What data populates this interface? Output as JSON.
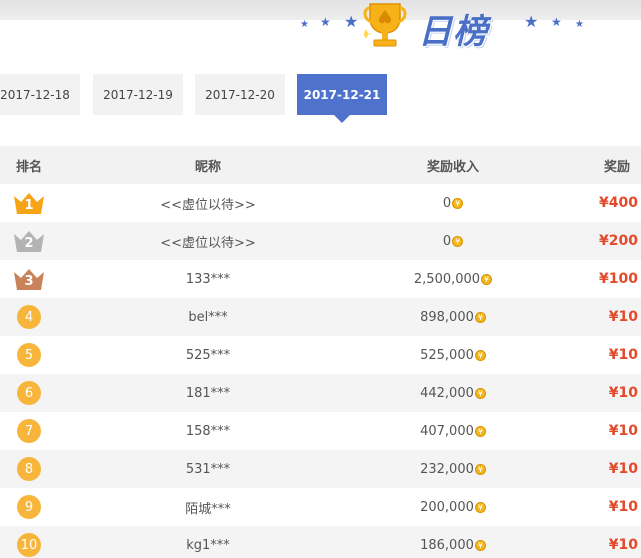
{
  "header": {
    "title": "日榜"
  },
  "tabs": [
    {
      "label": "2017-12-18",
      "active": false
    },
    {
      "label": "2017-12-19",
      "active": false
    },
    {
      "label": "2017-12-20",
      "active": false
    },
    {
      "label": "2017-12-21",
      "active": true
    }
  ],
  "table": {
    "headers": {
      "rank": "排名",
      "name": "昵称",
      "income": "奖励收入",
      "reward": "奖励"
    },
    "rows": [
      {
        "rank": "1",
        "name": "<<虚位以待>>",
        "income": "0",
        "reward": "¥400"
      },
      {
        "rank": "2",
        "name": "<<虚位以待>>",
        "income": "0",
        "reward": "¥200"
      },
      {
        "rank": "3",
        "name": "133***",
        "income": "2,500,000",
        "reward": "¥100"
      },
      {
        "rank": "4",
        "name": "bel***",
        "income": "898,000",
        "reward": "¥10"
      },
      {
        "rank": "5",
        "name": "525***",
        "income": "525,000",
        "reward": "¥10"
      },
      {
        "rank": "6",
        "name": "181***",
        "income": "442,000",
        "reward": "¥10"
      },
      {
        "rank": "7",
        "name": "158***",
        "income": "407,000",
        "reward": "¥10"
      },
      {
        "rank": "8",
        "name": "531***",
        "income": "232,000",
        "reward": "¥10"
      },
      {
        "rank": "9",
        "name": "陌城***",
        "income": "200,000",
        "reward": "¥10"
      },
      {
        "rank": "10",
        "name": "kg1***",
        "income": "186,000",
        "reward": "¥10"
      }
    ]
  },
  "coin_symbol": "¥",
  "colors": {
    "accent": "#4f72cc",
    "reward": "#e24a2b",
    "gold": "#f7a416",
    "silver": "#b3b3b3",
    "bronze": "#c9835a",
    "rank_circle": "#f7b53b"
  }
}
